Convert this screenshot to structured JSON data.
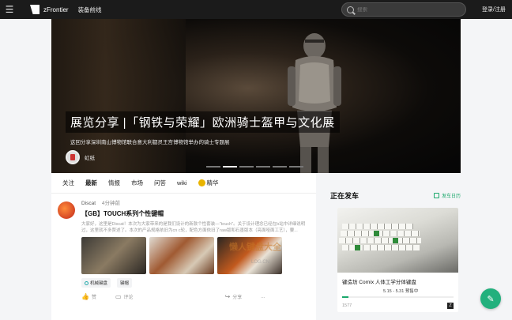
{
  "topbar": {
    "menu_icon": "menu-icon",
    "brand": "zFrontier",
    "nav_link": "装备前线",
    "search_placeholder": "搜索",
    "login": "登录/注册"
  },
  "banner": {
    "title": "展览分享 |「钢铁与荣耀」欧洲骑士盔甲与文化展",
    "subtitle": "这回分享深圳南山博物馆联合意大利都灵王宫博物馆举办的骑士专题展",
    "author": "虹纸",
    "slides": 6,
    "active_slide": 1
  },
  "feed": {
    "tabs": [
      "关注",
      "最新",
      "情报",
      "市场",
      "问答",
      "wiki",
      "精华"
    ],
    "active_tab": "最新",
    "post": {
      "author": "Discat",
      "time": "4分钟前",
      "title": "【GB】TOUCH系列个性键帽",
      "body": "大家好，这里是Discat！本次为大家带来的是我们设计的新款个性套装—\"touch\"。关于设计理念已经在b站中详细说明过，这里就不多赘述了。本次的产品规格依旧为cn c轮，配色方面依旧了raw版和石墨版本（亮面哑面工艺），要...",
      "tags": [
        "机械键盘",
        "键帽"
      ],
      "actions": {
        "like": "赞",
        "comment": "评论",
        "share": "分享",
        "more": "..."
      }
    }
  },
  "side": {
    "title": "正在发车",
    "calendar_link": "发车日历",
    "card": {
      "title": "键造坊 Cornix 人体工学分体键盘",
      "dates": "5.15 - 5.31 预售中",
      "count": "1577",
      "badge": "Z",
      "progress": 0.06
    }
  },
  "watermark": {
    "main": "懒人键盘大全",
    "sub": "LOG.CN"
  },
  "colors": {
    "accent": "#22b07d",
    "topbar": "#1b1b1b"
  }
}
